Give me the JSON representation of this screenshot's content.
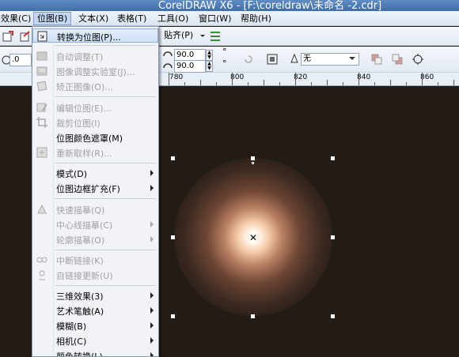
{
  "window": {
    "title": "CorelDRAW X6 - [F:\\coreldraw\\未命名 -2.cdr]"
  },
  "menubar": {
    "items": [
      {
        "label": "效果(C)"
      },
      {
        "label": "位图(B)"
      },
      {
        "label": "文本(X)"
      },
      {
        "label": "表格(T)"
      },
      {
        "label": "工具(O)"
      },
      {
        "label": "窗口(W)"
      },
      {
        "label": "帮助(H)"
      }
    ]
  },
  "toolbar": {
    "snap_label": "贴齐(P)",
    "position_value": ".0",
    "rotation_1": "90.0",
    "rotation_2": "90.0",
    "degree_symbol": "°",
    "outline_value": "无"
  },
  "ruler": {
    "labels": [
      "780",
      "800",
      "820",
      "840",
      "860"
    ]
  },
  "bitmap_menu": {
    "items": [
      {
        "label": "转换为位图(P)...",
        "enabled": true,
        "submenu": false,
        "highlighted": true,
        "icon": "convert-to-bitmap-icon"
      },
      {
        "label": "自动调整(T)",
        "enabled": false,
        "submenu": false,
        "icon": "auto-adjust-icon"
      },
      {
        "label": "图像调整实验室(J)...",
        "enabled": false,
        "submenu": false,
        "icon": "image-adjust-lab-icon"
      },
      {
        "label": "矫正图像(O)...",
        "enabled": false,
        "submenu": false,
        "icon": "straighten-image-icon"
      },
      {
        "label": "编辑位图(E)...",
        "enabled": false,
        "submenu": false,
        "icon": "edit-bitmap-icon"
      },
      {
        "label": "裁剪位图(I)",
        "enabled": false,
        "submenu": false,
        "icon": "crop-bitmap-icon"
      },
      {
        "label": "位图颜色遮罩(M)",
        "enabled": true,
        "submenu": false
      },
      {
        "label": "重新取样(R)...",
        "enabled": false,
        "submenu": false,
        "icon": "resample-icon"
      },
      {
        "label": "模式(D)",
        "enabled": true,
        "submenu": true
      },
      {
        "label": "位图边框扩充(F)",
        "enabled": true,
        "submenu": true
      },
      {
        "label": "快速描摹(Q)",
        "enabled": false,
        "submenu": false,
        "icon": "quick-trace-icon"
      },
      {
        "label": "中心线描摹(C)",
        "enabled": false,
        "submenu": true
      },
      {
        "label": "轮廓描摹(O)",
        "enabled": false,
        "submenu": true
      },
      {
        "label": "中断链接(K)",
        "enabled": false,
        "submenu": false,
        "icon": "break-link-icon"
      },
      {
        "label": "自链接更新(U)",
        "enabled": false,
        "submenu": false,
        "icon": "update-link-icon"
      },
      {
        "label": "三维效果(3)",
        "enabled": true,
        "submenu": true
      },
      {
        "label": "艺术笔触(A)",
        "enabled": true,
        "submenu": true
      },
      {
        "label": "模糊(B)",
        "enabled": true,
        "submenu": true
      },
      {
        "label": "相机(C)",
        "enabled": true,
        "submenu": true
      },
      {
        "label": "颜色转换(L)",
        "enabled": true,
        "submenu": true
      }
    ]
  }
}
